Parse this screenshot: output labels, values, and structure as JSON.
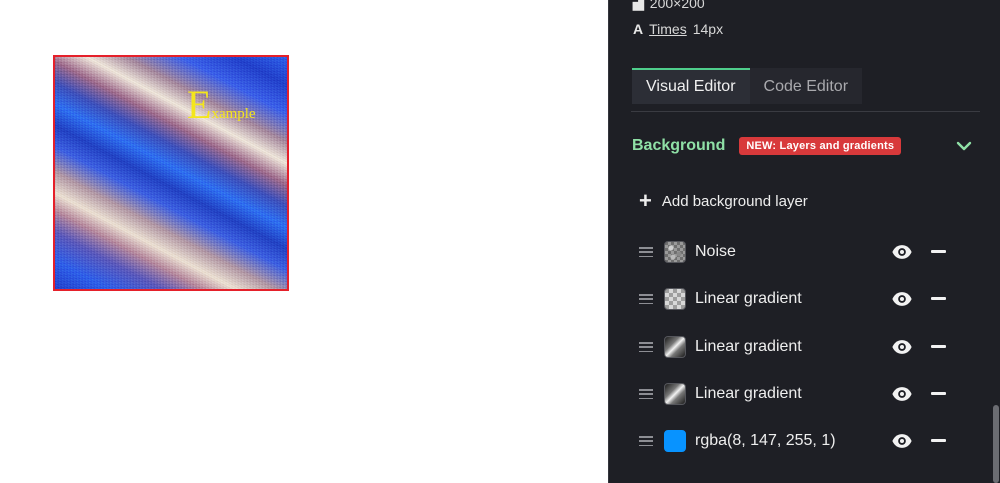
{
  "preview": {
    "text_big": "E",
    "text_small": "xample",
    "border_color": "#e5202a",
    "text_color": "#f4e61c"
  },
  "panel": {
    "meta": {
      "size": "200×200",
      "font_name": "Times",
      "font_size": "14px",
      "font_icon": "A"
    },
    "tabs": [
      {
        "label": "Visual Editor",
        "active": true
      },
      {
        "label": "Code Editor",
        "active": false
      }
    ],
    "background": {
      "title": "Background",
      "badge": "NEW: Layers and gradients",
      "add_layer_label": "Add background layer",
      "layers": [
        {
          "label": "Noise",
          "swatch": "noise"
        },
        {
          "label": "Linear gradient",
          "swatch": "checker"
        },
        {
          "label": "Linear gradient",
          "swatch": "linear"
        },
        {
          "label": "Linear gradient",
          "swatch": "linear"
        },
        {
          "label": "rgba(8, 147, 255, 1)",
          "swatch": "solid",
          "color": "#0893ff"
        }
      ]
    },
    "colors": {
      "accent_green": "#4fce8c",
      "title_green": "#8fe0a6",
      "badge_red": "#d8393b"
    }
  }
}
